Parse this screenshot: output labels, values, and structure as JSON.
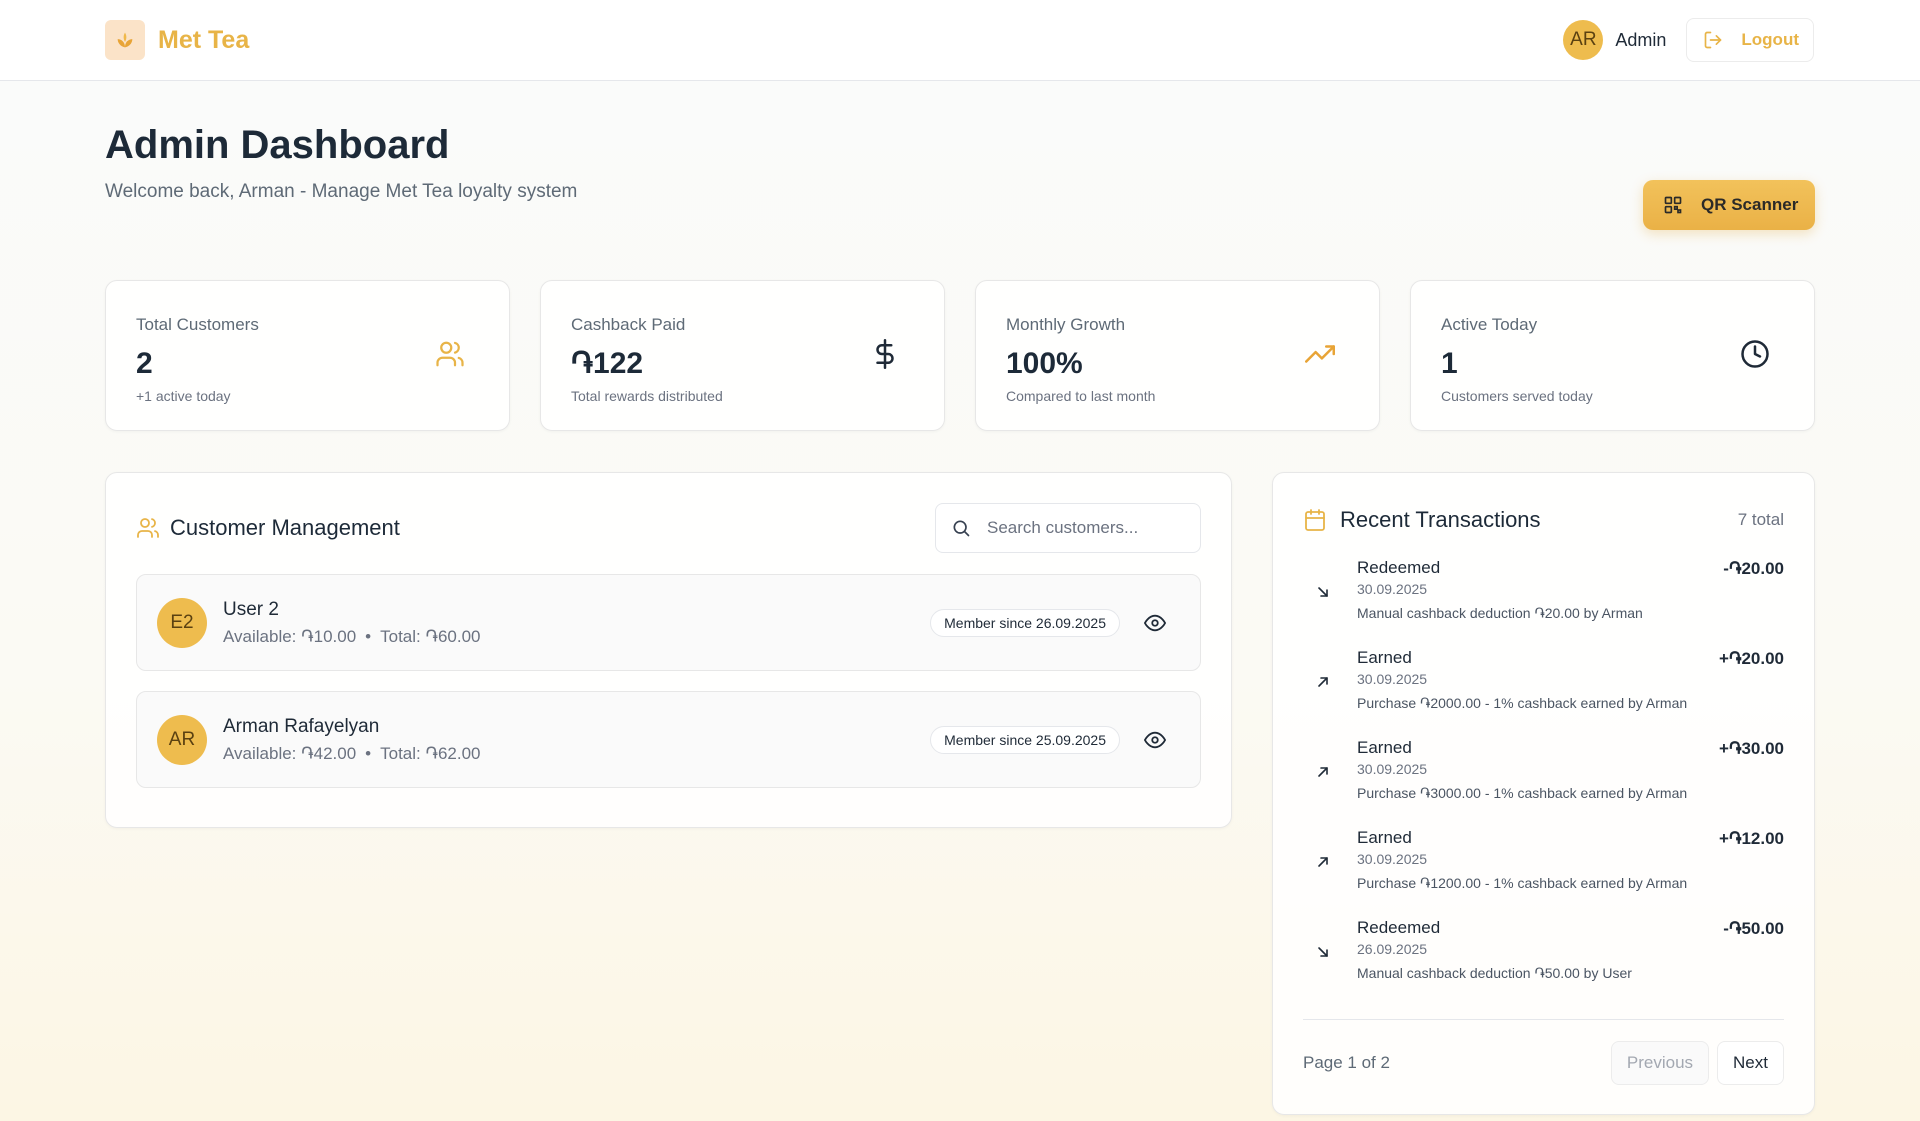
{
  "header": {
    "brand": "Met Tea",
    "user_initials": "AR",
    "user_name": "Admin",
    "logout_label": "Logout"
  },
  "page": {
    "title": "Admin Dashboard",
    "subtitle": "Welcome back, Arman - Manage Met Tea loyalty system",
    "qr_label": "QR Scanner"
  },
  "stats": [
    {
      "label": "Total Customers",
      "value": "2",
      "sub": "+1 active today",
      "icon": "users-icon"
    },
    {
      "label": "Cashback Paid",
      "value": "֏122",
      "sub": "Total rewards distributed",
      "icon": "dollar-icon"
    },
    {
      "label": "Monthly Growth",
      "value": "100%",
      "sub": "Compared to last month",
      "icon": "trending-up-icon"
    },
    {
      "label": "Active Today",
      "value": "1",
      "sub": "Customers served today",
      "icon": "clock-icon"
    }
  ],
  "customers": {
    "title": "Customer Management",
    "search_placeholder": "Search customers...",
    "items": [
      {
        "initials": "E2",
        "name": "User 2",
        "available": "Available: ֏10.00",
        "total": "Total: ֏60.00",
        "since": "Member since 26.09.2025"
      },
      {
        "initials": "AR",
        "name": "Arman Rafayelyan",
        "available": "Available: ֏42.00",
        "total": "Total: ֏62.00",
        "since": "Member since 25.09.2025"
      }
    ]
  },
  "transactions": {
    "title": "Recent Transactions",
    "count": "7 total",
    "items": [
      {
        "type": "Redeemed",
        "date": "30.09.2025",
        "desc": "Manual cashback deduction ֏20.00 by Arman",
        "amount": "-֏20.00",
        "direction": "down"
      },
      {
        "type": "Earned",
        "date": "30.09.2025",
        "desc": "Purchase ֏2000.00 - 1% cashback earned by Arman",
        "amount": "+֏20.00",
        "direction": "up"
      },
      {
        "type": "Earned",
        "date": "30.09.2025",
        "desc": "Purchase ֏3000.00 - 1% cashback earned by Arman",
        "amount": "+֏30.00",
        "direction": "up"
      },
      {
        "type": "Earned",
        "date": "30.09.2025",
        "desc": "Purchase ֏1200.00 - 1% cashback earned by Arman",
        "amount": "+֏12.00",
        "direction": "up"
      },
      {
        "type": "Redeemed",
        "date": "26.09.2025",
        "desc": "Manual cashback deduction ֏50.00 by User",
        "amount": "-֏50.00",
        "direction": "down"
      }
    ],
    "page_info": "Page 1 of 2",
    "prev_label": "Previous",
    "next_label": "Next"
  },
  "colors": {
    "accent": "#e8b447",
    "avatar_bg": "#eebc4e",
    "text_dark": "#1d2a38"
  }
}
